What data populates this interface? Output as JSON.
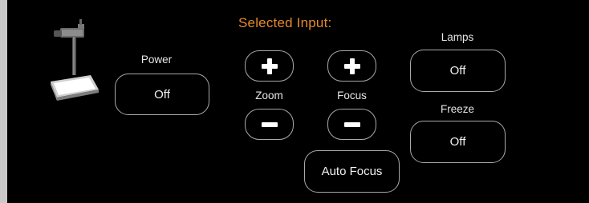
{
  "title": "Selected Input:",
  "device": {
    "icon": "document-camera-icon"
  },
  "power": {
    "label": "Power",
    "value": "Off"
  },
  "zoom": {
    "label": "Zoom",
    "plus_icon": "plus-icon",
    "minus_icon": "minus-icon"
  },
  "focus": {
    "label": "Focus",
    "plus_icon": "plus-icon",
    "minus_icon": "minus-icon",
    "auto_label": "Auto Focus"
  },
  "lamps": {
    "label": "Lamps",
    "value": "Off"
  },
  "freeze": {
    "label": "Freeze",
    "value": "Off"
  },
  "colors": {
    "accent": "#e48a2a",
    "background": "#000000",
    "border": "#a9a9a9",
    "text": "#e6e6e6"
  }
}
